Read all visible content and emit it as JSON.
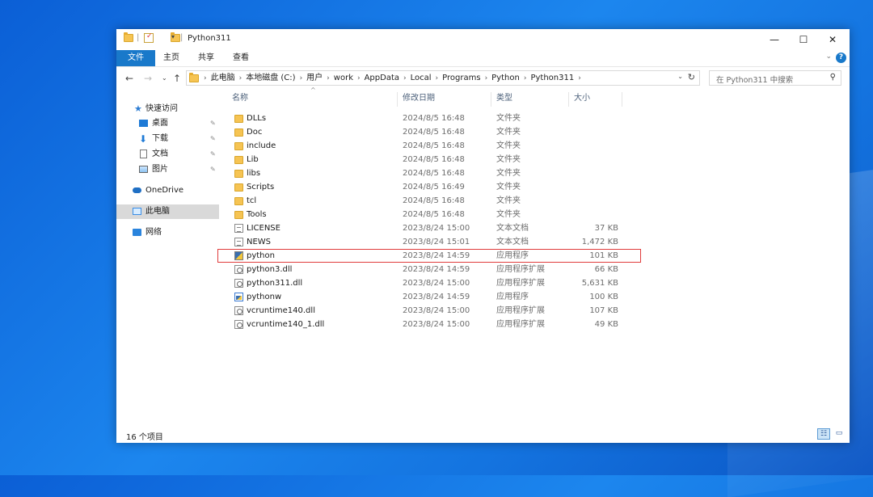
{
  "window": {
    "title": "Python311",
    "minimize": "—",
    "maximize": "☐",
    "close": "✕"
  },
  "ribbon": {
    "tabs": [
      "文件",
      "主页",
      "共享",
      "查看"
    ]
  },
  "address": {
    "crumbs": [
      "此电脑",
      "本地磁盘 (C:)",
      "用户",
      "work",
      "AppData",
      "Local",
      "Programs",
      "Python",
      "Python311"
    ]
  },
  "search": {
    "placeholder": "在 Python311 中搜索"
  },
  "nav": {
    "quick_access": "快速访问",
    "items": [
      "桌面",
      "下载",
      "文档",
      "图片"
    ],
    "onedrive": "OneDrive",
    "this_pc": "此电脑",
    "network": "网络"
  },
  "columns": {
    "name": "名称",
    "date": "修改日期",
    "type": "类型",
    "size": "大小"
  },
  "files": [
    {
      "name": "DLLs",
      "date": "2024/8/5 16:48",
      "type": "文件夹",
      "size": "",
      "icon": "folder"
    },
    {
      "name": "Doc",
      "date": "2024/8/5 16:48",
      "type": "文件夹",
      "size": "",
      "icon": "folder"
    },
    {
      "name": "include",
      "date": "2024/8/5 16:48",
      "type": "文件夹",
      "size": "",
      "icon": "folder"
    },
    {
      "name": "Lib",
      "date": "2024/8/5 16:48",
      "type": "文件夹",
      "size": "",
      "icon": "folder"
    },
    {
      "name": "libs",
      "date": "2024/8/5 16:48",
      "type": "文件夹",
      "size": "",
      "icon": "folder"
    },
    {
      "name": "Scripts",
      "date": "2024/8/5 16:49",
      "type": "文件夹",
      "size": "",
      "icon": "folder"
    },
    {
      "name": "tcl",
      "date": "2024/8/5 16:48",
      "type": "文件夹",
      "size": "",
      "icon": "folder"
    },
    {
      "name": "Tools",
      "date": "2024/8/5 16:48",
      "type": "文件夹",
      "size": "",
      "icon": "folder"
    },
    {
      "name": "LICENSE",
      "date": "2023/8/24 15:00",
      "type": "文本文档",
      "size": "37 KB",
      "icon": "doc"
    },
    {
      "name": "NEWS",
      "date": "2023/8/24 15:01",
      "type": "文本文档",
      "size": "1,472 KB",
      "icon": "doc"
    },
    {
      "name": "python",
      "date": "2023/8/24 14:59",
      "type": "应用程序",
      "size": "101 KB",
      "icon": "exe"
    },
    {
      "name": "python3.dll",
      "date": "2023/8/24 14:59",
      "type": "应用程序扩展",
      "size": "66 KB",
      "icon": "dll"
    },
    {
      "name": "python311.dll",
      "date": "2023/8/24 15:00",
      "type": "应用程序扩展",
      "size": "5,631 KB",
      "icon": "dll"
    },
    {
      "name": "pythonw",
      "date": "2023/8/24 14:59",
      "type": "应用程序",
      "size": "100 KB",
      "icon": "exew"
    },
    {
      "name": "vcruntime140.dll",
      "date": "2023/8/24 15:00",
      "type": "应用程序扩展",
      "size": "107 KB",
      "icon": "dll"
    },
    {
      "name": "vcruntime140_1.dll",
      "date": "2023/8/24 15:00",
      "type": "应用程序扩展",
      "size": "49 KB",
      "icon": "dll"
    }
  ],
  "status": {
    "count": "16 个项目"
  },
  "colors": {
    "accent": "#1979ca",
    "highlight": "#e03c3c",
    "folder": "#f6c453"
  }
}
